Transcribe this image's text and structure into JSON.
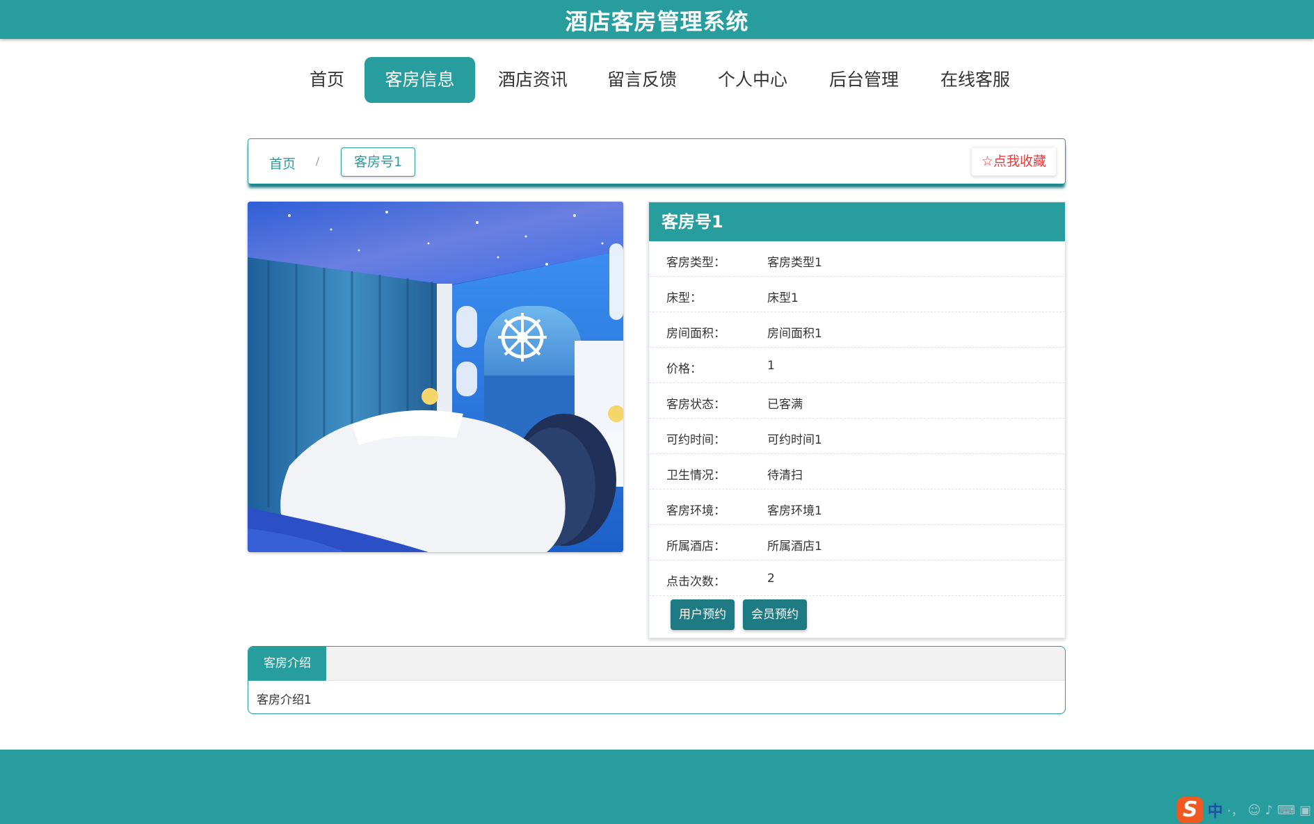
{
  "app": {
    "title": "酒店客房管理系统"
  },
  "nav": {
    "items": [
      {
        "label": "首页"
      },
      {
        "label": "客房信息"
      },
      {
        "label": "酒店资讯"
      },
      {
        "label": "留言反馈"
      },
      {
        "label": "个人中心"
      },
      {
        "label": "后台管理"
      },
      {
        "label": "在线客服"
      }
    ],
    "active": "客房信息"
  },
  "breadcrumb": {
    "home": "首页",
    "separator": "/",
    "current": "客房号1"
  },
  "favorite_button": {
    "label": "点我收藏",
    "icon": "star-outline-icon"
  },
  "room": {
    "title": "客房号1",
    "fields": [
      {
        "key": "客房类型：",
        "value": "客房类型1"
      },
      {
        "key": "床型：",
        "value": "床型1"
      },
      {
        "key": "房间面积：",
        "value": "房间面积1"
      },
      {
        "key": "价格：",
        "value": "1"
      },
      {
        "key": "客房状态：",
        "value": "已客满"
      },
      {
        "key": "可约时间：",
        "value": "可约时间1"
      },
      {
        "key": "卫生情况：",
        "value": "待清扫"
      },
      {
        "key": "客房环境：",
        "value": "客房环境1"
      },
      {
        "key": "所属酒店：",
        "value": "所属酒店1"
      },
      {
        "key": "点击次数：",
        "value": "2"
      }
    ],
    "actions": {
      "user_booking": "用户预约",
      "member_booking": "会员预约"
    }
  },
  "intro": {
    "tab_label": "客房介绍",
    "content": "客房介绍1"
  },
  "ime": {
    "char": "中",
    "hint": "·，"
  },
  "colors": {
    "primary": "#279d9e",
    "button": "#1e7b84",
    "favorite": "#e63c3c"
  }
}
